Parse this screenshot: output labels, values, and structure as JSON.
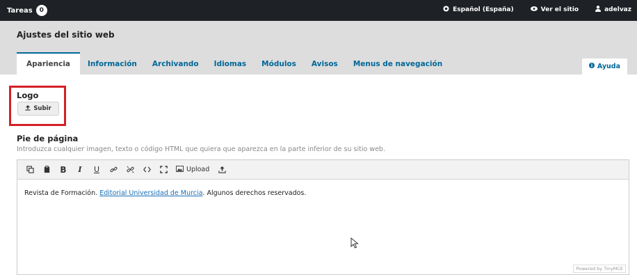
{
  "topbar": {
    "tasks_label": "Tareas",
    "tasks_count": "0",
    "language": "Español (España)",
    "view_site": "Ver el sitio",
    "user": "adelvaz"
  },
  "page": {
    "title": "Ajustes del sitio web"
  },
  "tabs": [
    {
      "label": "Apariencia",
      "active": true
    },
    {
      "label": "Información"
    },
    {
      "label": "Archivando"
    },
    {
      "label": "Idiomas"
    },
    {
      "label": "Módulos"
    },
    {
      "label": "Avisos"
    },
    {
      "label": "Menus de navegación"
    }
  ],
  "help": {
    "label": "Ayuda"
  },
  "logo": {
    "label": "Logo",
    "upload_label": "Subir"
  },
  "footer": {
    "label": "Pie de página",
    "description": "Introduzca cualquier imagen, texto o código HTML que quiera que aparezca en la parte inferior de su sitio web."
  },
  "editor": {
    "toolbar": {
      "upload_label": "Upload"
    },
    "content_prefix": "Revista de Formación. ",
    "content_link": "Editorial Universidad de Murcia",
    "content_suffix": ". Algunos derechos reservados.",
    "powered_by": "Powered by TinyMCE"
  },
  "icons": {
    "language": "globe-icon",
    "view_site": "eye-icon",
    "user": "user-icon",
    "help": "info-icon",
    "upload": "upload-icon"
  },
  "colors": {
    "topbar": "#1e2226",
    "accent": "#006798",
    "highlight": "#d32027"
  }
}
